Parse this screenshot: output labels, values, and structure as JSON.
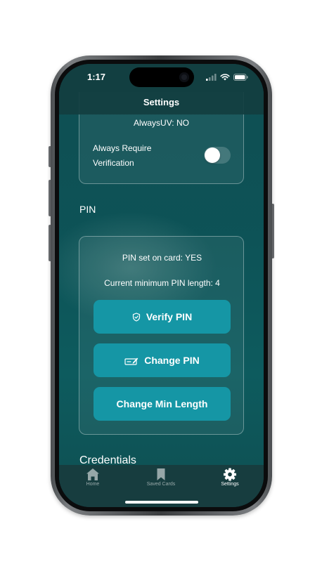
{
  "status_bar": {
    "time": "1:17",
    "icons": [
      "signal-icon",
      "wifi-icon",
      "battery-icon"
    ]
  },
  "nav": {
    "title": "Settings"
  },
  "top_card": {
    "always_uv_text": "AlwaysUV: NO",
    "require_verification_label": "Always Require Verification",
    "require_verification_enabled": false
  },
  "pin_section": {
    "heading": "PIN",
    "pin_set_text": "PIN set on card: YES",
    "min_length_text": "Current minimum PIN length: 4",
    "verify_button": "Verify PIN",
    "change_button": "Change PIN",
    "min_length_button": "Change Min Length"
  },
  "credentials_section": {
    "heading": "Credentials"
  },
  "tab_bar": {
    "items": [
      {
        "label": "Home",
        "icon": "home-icon",
        "active": false
      },
      {
        "label": "Saved Cards",
        "icon": "bookmark-icon",
        "active": false
      },
      {
        "label": "Settings",
        "icon": "gear-icon",
        "active": true
      }
    ]
  },
  "colors": {
    "screen_background": "#0d5357",
    "button": "#1596a5",
    "text": "#ffffff"
  }
}
